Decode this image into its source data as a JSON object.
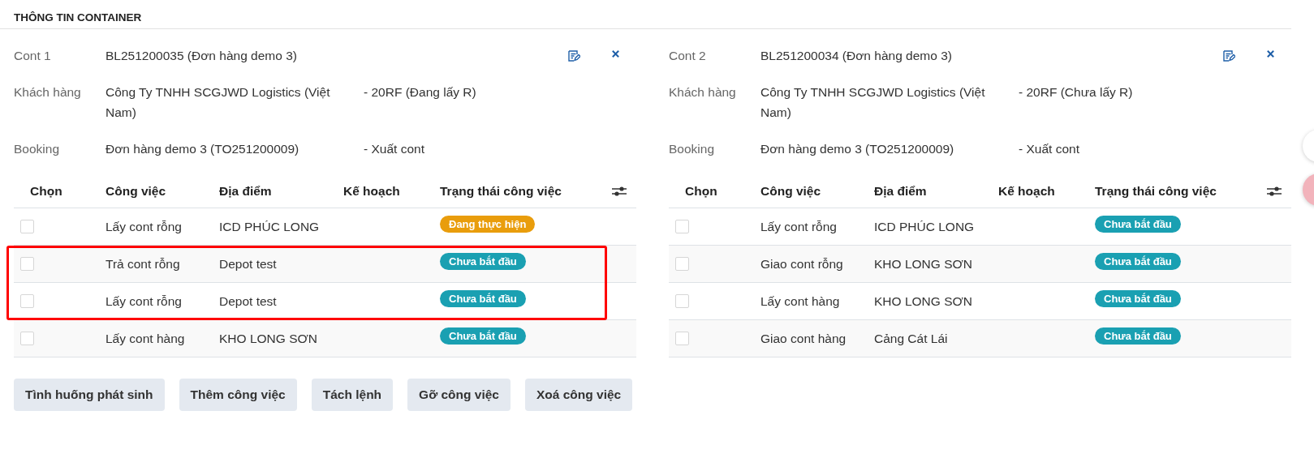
{
  "section_title": "THÔNG TIN CONTAINER",
  "containers": [
    {
      "label": "Cont 1",
      "value": "BL251200035 (Đơn hàng demo 3)",
      "customer_label": "Khách hàng",
      "customer": "Công Ty TNHH SCGJWD Logistics (Việt Nam)",
      "type_note": "- 20RF (Đang lấy R)",
      "booking_label": "Booking",
      "booking": "Đơn hàng demo 3 (TO251200009)",
      "booking_note": "- Xuất cont",
      "columns": [
        "Chọn",
        "Công việc",
        "Địa điểm",
        "Kế hoạch",
        "Trạng thái công việc"
      ],
      "rows": [
        {
          "checked": false,
          "job": "Lấy cont rỗng",
          "place": "ICD PHÚC LONG",
          "status": "Đang thực hiện",
          "kind": "in_progress",
          "highlighted": false
        },
        {
          "checked": false,
          "job": "Trả cont rỗng",
          "place": "Depot test",
          "status": "Chưa bắt đầu",
          "kind": "not_started",
          "highlighted": true
        },
        {
          "checked": false,
          "job": "Lấy cont rỗng",
          "place": "Depot test",
          "status": "Chưa bắt đầu",
          "kind": "not_started",
          "highlighted": true
        },
        {
          "checked": false,
          "job": "Lấy cont hàng",
          "place": "KHO LONG SƠN",
          "status": "Chưa bắt đầu",
          "kind": "not_started",
          "highlighted": false
        }
      ]
    },
    {
      "label": "Cont 2",
      "value": "BL251200034 (Đơn hàng demo 3)",
      "customer_label": "Khách hàng",
      "customer": "Công Ty TNHH SCGJWD Logistics (Việt Nam)",
      "type_note": "- 20RF (Chưa lấy R)",
      "booking_label": "Booking",
      "booking": "Đơn hàng demo 3 (TO251200009)",
      "booking_note": "- Xuất cont",
      "columns": [
        "Chọn",
        "Công việc",
        "Địa điểm",
        "Kế hoạch",
        "Trạng thái công việc"
      ],
      "rows": [
        {
          "checked": false,
          "job": "Lấy cont rỗng",
          "place": "ICD PHÚC LONG",
          "status": "Chưa bắt đầu",
          "kind": "not_started",
          "highlighted": false
        },
        {
          "checked": false,
          "job": "Giao cont rỗng",
          "place": "KHO LONG SƠN",
          "status": "Chưa bắt đầu",
          "kind": "not_started",
          "highlighted": false
        },
        {
          "checked": false,
          "job": "Lấy cont hàng",
          "place": "KHO LONG SƠN",
          "status": "Chưa bắt đầu",
          "kind": "not_started",
          "highlighted": false
        },
        {
          "checked": false,
          "job": "Giao cont hàng",
          "place": "Cảng Cát Lái",
          "status": "Chưa bắt đầu",
          "kind": "not_started",
          "highlighted": false
        }
      ]
    }
  ],
  "buttons": [
    "Tình huống phát sinh",
    "Thêm công việc",
    "Tách lệnh",
    "Gỡ công việc",
    "Xoá công việc"
  ]
}
